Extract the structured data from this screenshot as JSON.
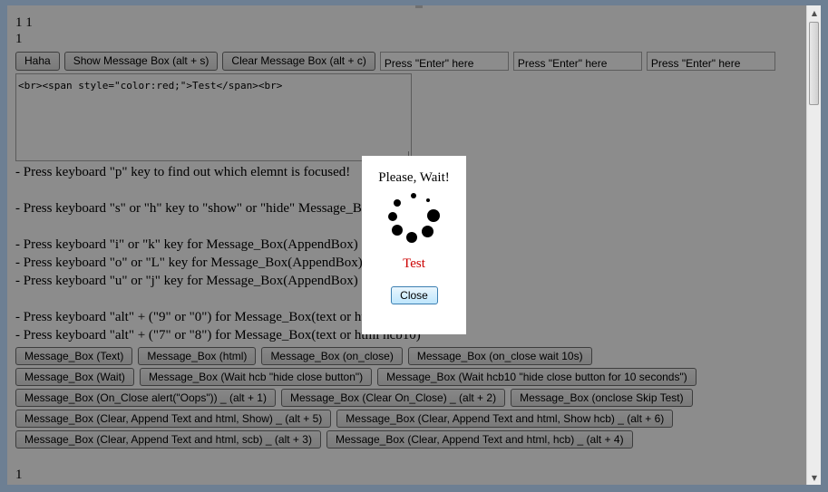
{
  "top_lines": [
    "1 1",
    "1"
  ],
  "toolbar": {
    "buttons": [
      "Haha",
      "Show Message Box (alt + s)",
      "Clear Message Box (alt + c)"
    ],
    "inputs": [
      "Press \"Enter\" here",
      "Press \"Enter\" here",
      "Press \"Enter\" here"
    ]
  },
  "textarea_value": "<br><span style=\"color:red;\">Test</span><br>",
  "instructions": [
    "- Press keyboard \"p\" key to find out which elemnt is focused!",
    "",
    "- Press keyboard \"s\" or \"h\" key to \"show\" or \"hide\" Message_Box by the button!",
    "",
    "- Press keyboard \"i\" or \"k\" key for Message_Box(AppendBox)",
    "- Press keyboard \"o\" or \"L\" key for Message_Box(AppendBox) (html)",
    "- Press keyboard \"u\" or \"j\" key for Message_Box(AppendBox) (text or scb or hcb)",
    "",
    "- Press keyboard \"alt\" + (\"9\" or \"0\") for Message_Box(text or html)",
    "- Press keyboard \"alt\" + (\"7\" or \"8\") for Message_Box(text or html hcb10)"
  ],
  "button_rows": [
    [
      "Message_Box (Text)",
      "Message_Box (html)",
      "Message_Box (on_close)",
      "Message_Box (on_close wait 10s)"
    ],
    [
      "Message_Box (Wait)",
      "Message_Box (Wait hcb \"hide close button\")",
      "Message_Box (Wait hcb10 \"hide close button for 10 seconds\")"
    ],
    [
      "Message_Box (On_Close alert(\"Oops\")) _ (alt + 1)",
      "Message_Box (Clear On_Close) _ (alt + 2)",
      "Message_Box (onclose Skip Test)"
    ],
    [
      "Message_Box (Clear, Append Text and html, Show) _ (alt + 5)",
      "Message_Box (Clear, Append Text and html, Show hcb) _ (alt + 6)"
    ],
    [
      "Message_Box (Clear, Append Text and html, scb) _ (alt + 3)",
      "Message_Box (Clear, Append Text and html, hcb) _ (alt + 4)"
    ]
  ],
  "bottom_line": "1",
  "dialog": {
    "title": "Please, Wait!",
    "message": "Test",
    "close_label": "Close",
    "message_color": "#cc0000"
  }
}
